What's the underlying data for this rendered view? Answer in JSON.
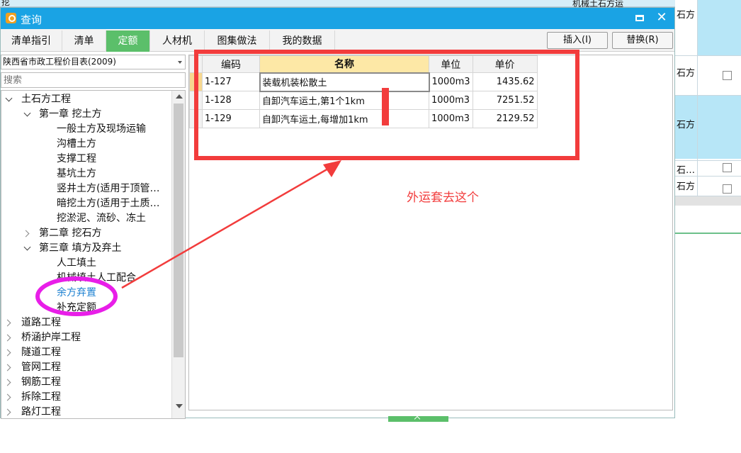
{
  "background": {
    "top_left_text": "挖",
    "top_right_text": "机械土石方运",
    "cells": [
      "石方",
      "石方",
      "石方",
      "石…",
      "石方"
    ]
  },
  "dialog": {
    "title": "查询",
    "tabs": [
      "清单指引",
      "清单",
      "定额",
      "人材机",
      "图集做法",
      "我的数据"
    ],
    "active_tab": "定额",
    "insert_button": "插入(I)",
    "replace_button": "替换(R)"
  },
  "left": {
    "library": "陕西省市政工程价目表(2009)",
    "search_placeholder": "搜索",
    "tree": [
      {
        "label": "土石方工程"
      },
      {
        "label": "第一章  挖土方"
      },
      {
        "label": "一般土方及现场运输"
      },
      {
        "label": "沟槽土方"
      },
      {
        "label": "支撑工程"
      },
      {
        "label": "基坑土方"
      },
      {
        "label": "竖井土方(适用于顶管…"
      },
      {
        "label": "暗挖土方(适用于土质…"
      },
      {
        "label": "挖淤泥、流砂、冻土"
      },
      {
        "label": "第二章  挖石方"
      },
      {
        "label": "第三章  填方及弃土"
      },
      {
        "label": "人工填土"
      },
      {
        "label": "机械填土人工配合"
      },
      {
        "label": "余方弃置"
      },
      {
        "label": "补充定额"
      },
      {
        "label": "道路工程"
      },
      {
        "label": "桥涵护岸工程"
      },
      {
        "label": "隧道工程"
      },
      {
        "label": "管网工程"
      },
      {
        "label": "钢筋工程"
      },
      {
        "label": "拆除工程"
      },
      {
        "label": "路灯工程"
      }
    ]
  },
  "grid": {
    "headers": {
      "code": "编码",
      "name": "名称",
      "unit": "单位",
      "price": "单价"
    },
    "rows": [
      {
        "code": "1-127",
        "name": "装载机装松散土",
        "unit": "1000m3",
        "price": "1435.62"
      },
      {
        "code": "1-128",
        "name": "自卸汽车运土,第1个1km",
        "unit": "1000m3",
        "price": "7251.52"
      },
      {
        "code": "1-129",
        "name": "自卸汽车运土,每增加1km",
        "unit": "1000m3",
        "price": "2129.52"
      }
    ]
  },
  "annotation": {
    "note": "外运套去这个",
    "red": "#f23c3c",
    "magenta": "#e81ee8"
  },
  "colors": {
    "titlebar": "#1aa3e4",
    "active_tab": "#5bbf6a",
    "name_header": "#fde8a6",
    "selected_tree": "#1a7fd0"
  }
}
